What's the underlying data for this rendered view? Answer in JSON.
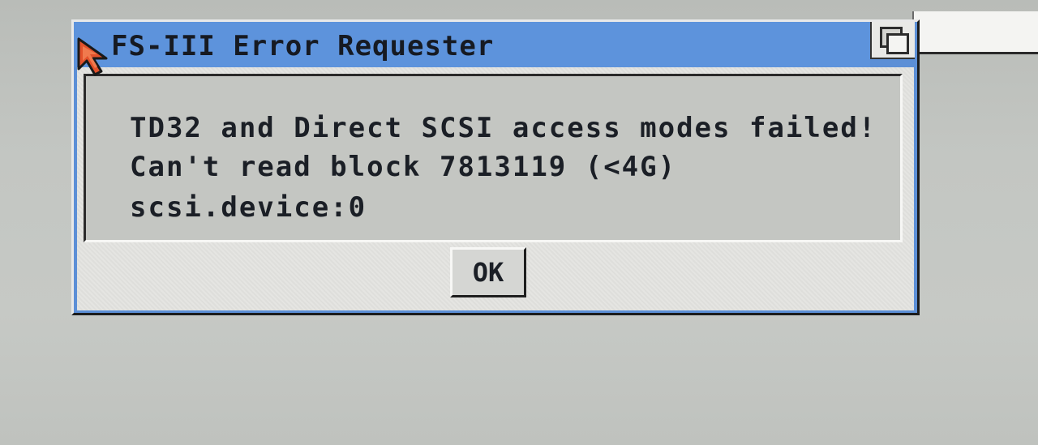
{
  "requester": {
    "title": "FS-III Error Requester",
    "message_lines": [
      "TD32 and Direct SCSI access modes failed!",
      "Can't read block 7813119 (<4G)",
      "scsi.device:0"
    ],
    "ok_label": "OK"
  },
  "icons": {
    "pointer": "mouse-pointer-icon",
    "depth": "depth-arrange-icon"
  },
  "colors": {
    "title_bar": "#5d93dc",
    "pointer": "#e2512b",
    "body": "#e5e5e2",
    "message_bg": "#c4c6c2",
    "screen_bg": "#c3c6c2"
  }
}
